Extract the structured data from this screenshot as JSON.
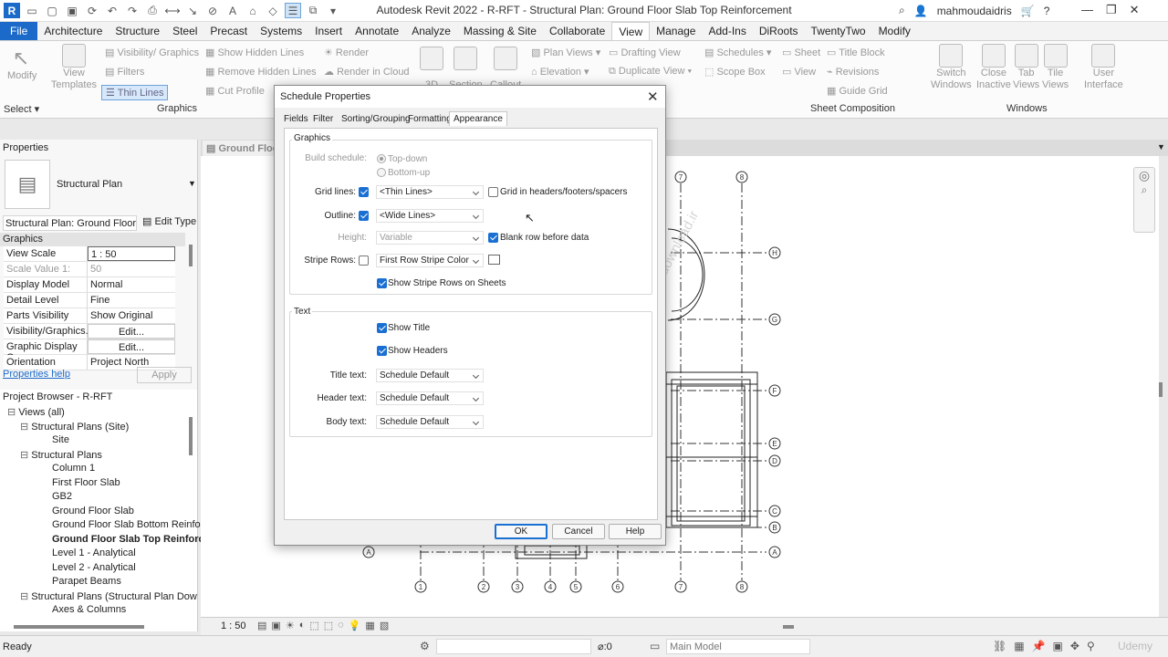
{
  "app": {
    "title": "Autodesk Revit 2022 - R-RFT - Structural Plan: Ground Floor Slab Top Reinforcement",
    "user": "mahmoudaidris"
  },
  "ribbon": {
    "tabs": [
      "File",
      "Architecture",
      "Structure",
      "Steel",
      "Precast",
      "Systems",
      "Insert",
      "Annotate",
      "Analyze",
      "Massing & Site",
      "Collaborate",
      "View",
      "Manage",
      "Add-Ins",
      "DiRoots",
      "TwentyTwo",
      "Modify"
    ],
    "active_tab": "View",
    "modify": "Modify",
    "select": "Select",
    "view_templates": "View\nTemplates",
    "vg": "Visibility/ Graphics",
    "filters": "Filters",
    "thin_lines": "Thin Lines",
    "show_hidden": "Show Hidden Lines",
    "remove_hidden": "Remove Hidden Lines",
    "cut_profile": "Cut Profile",
    "render": "Render",
    "render_cloud": "Render in Cloud",
    "graphics": "Graphics",
    "three_d": "3D",
    "section": "Section",
    "callout": "Callout",
    "plan_views": "Plan Views",
    "elevation": "Elevation",
    "drafting_view": "Drafting View",
    "duplicate_view": "Duplicate View",
    "schedules": "Schedules",
    "scope_box": "Scope Box",
    "sheet": "Sheet",
    "view": "View",
    "title_block": "Title Block",
    "revisions": "Revisions",
    "guide_grid": "Guide Grid",
    "sheet_composition": "Sheet Composition",
    "switch_windows": "Switch\nWindows",
    "close_inactive": "Close\nInactive",
    "tab_views": "Tab\nViews",
    "tile_views": "Tile\nViews",
    "user_interface": "User\nInterface",
    "windows": "Windows"
  },
  "properties": {
    "header": "Properties",
    "type": "Structural Plan",
    "instance": "Structural Plan: Ground Floor",
    "edit_type": "Edit Type",
    "section": "Graphics",
    "rows": [
      {
        "k": "View Scale",
        "v": "1 : 50"
      },
      {
        "k": "Scale Value    1:",
        "v": "50"
      },
      {
        "k": "Display Model",
        "v": "Normal"
      },
      {
        "k": "Detail Level",
        "v": "Fine"
      },
      {
        "k": "Parts Visibility",
        "v": "Show Original"
      },
      {
        "k": "Visibility/Graphics...",
        "v": "Edit..."
      },
      {
        "k": "Graphic Display O...",
        "v": "Edit..."
      },
      {
        "k": "Orientation",
        "v": "Project North"
      }
    ],
    "help": "Properties help",
    "apply": "Apply"
  },
  "browser": {
    "header": "Project Browser - R-RFT",
    "items": [
      {
        "label": "Views (all)",
        "level": 0
      },
      {
        "label": "Structural Plans (Site)",
        "level": 1
      },
      {
        "label": "Site",
        "level": 2
      },
      {
        "label": "Structural Plans",
        "level": 1
      },
      {
        "label": "Column 1",
        "level": 2
      },
      {
        "label": "First Floor Slab",
        "level": 2
      },
      {
        "label": "GB2",
        "level": 2
      },
      {
        "label": "Ground Floor Slab",
        "level": 2
      },
      {
        "label": "Ground Floor Slab Bottom Reinfo",
        "level": 2
      },
      {
        "label": "Ground Floor Slab Top Reinforc",
        "level": 2,
        "bold": true
      },
      {
        "label": "Level 1 - Analytical",
        "level": 2
      },
      {
        "label": "Level 2 - Analytical",
        "level": 2
      },
      {
        "label": "Parapet Beams",
        "level": 2
      },
      {
        "label": "Structural Plans (Structural Plan Dow",
        "level": 1
      },
      {
        "label": "Axes & Columns",
        "level": 2
      }
    ]
  },
  "canvas": {
    "tab": "Ground Floo",
    "scale": "1 : 50",
    "watermark": "Copyright © 2025 - www.p30download.ir",
    "grid_top": [
      "7",
      "8"
    ],
    "grid_bottom": [
      "1",
      "2",
      "3",
      "4",
      "5",
      "6",
      "7",
      "8"
    ],
    "grid_right": [
      "H",
      "G",
      "F",
      "E",
      "D",
      "C",
      "B",
      "A"
    ],
    "grid_left": "A"
  },
  "status": {
    "ready": "Ready",
    "zero": ":0",
    "model": "Main Model",
    "udemy": "Udemy"
  },
  "dialog": {
    "title": "Schedule Properties",
    "tabs": [
      "Fields",
      "Filter",
      "Sorting/Grouping",
      "Formatting",
      "Appearance"
    ],
    "active_tab": "Appearance",
    "graphics_group": "Graphics",
    "build_schedule": "Build schedule:",
    "top_down": "Top-down",
    "bottom_up": "Bottom-up",
    "grid_lines": "Grid lines:",
    "grid_lines_value": "<Thin Lines>",
    "grid_in_headers": "Grid in headers/footers/spacers",
    "outline": "Outline:",
    "outline_value": "<Wide Lines>",
    "height": "Height:",
    "height_value": "Variable",
    "blank_row": "Blank row before data",
    "stripe_rows": "Stripe Rows:",
    "stripe_color": "First Row Stripe Color",
    "show_stripe": "Show Stripe Rows on Sheets",
    "text_group": "Text",
    "show_title": "Show Title",
    "show_headers": "Show Headers",
    "title_text": "Title text:",
    "header_text": "Header text:",
    "body_text": "Body text:",
    "schedule_default": "Schedule Default",
    "ok": "OK",
    "cancel": "Cancel",
    "help": "Help"
  }
}
